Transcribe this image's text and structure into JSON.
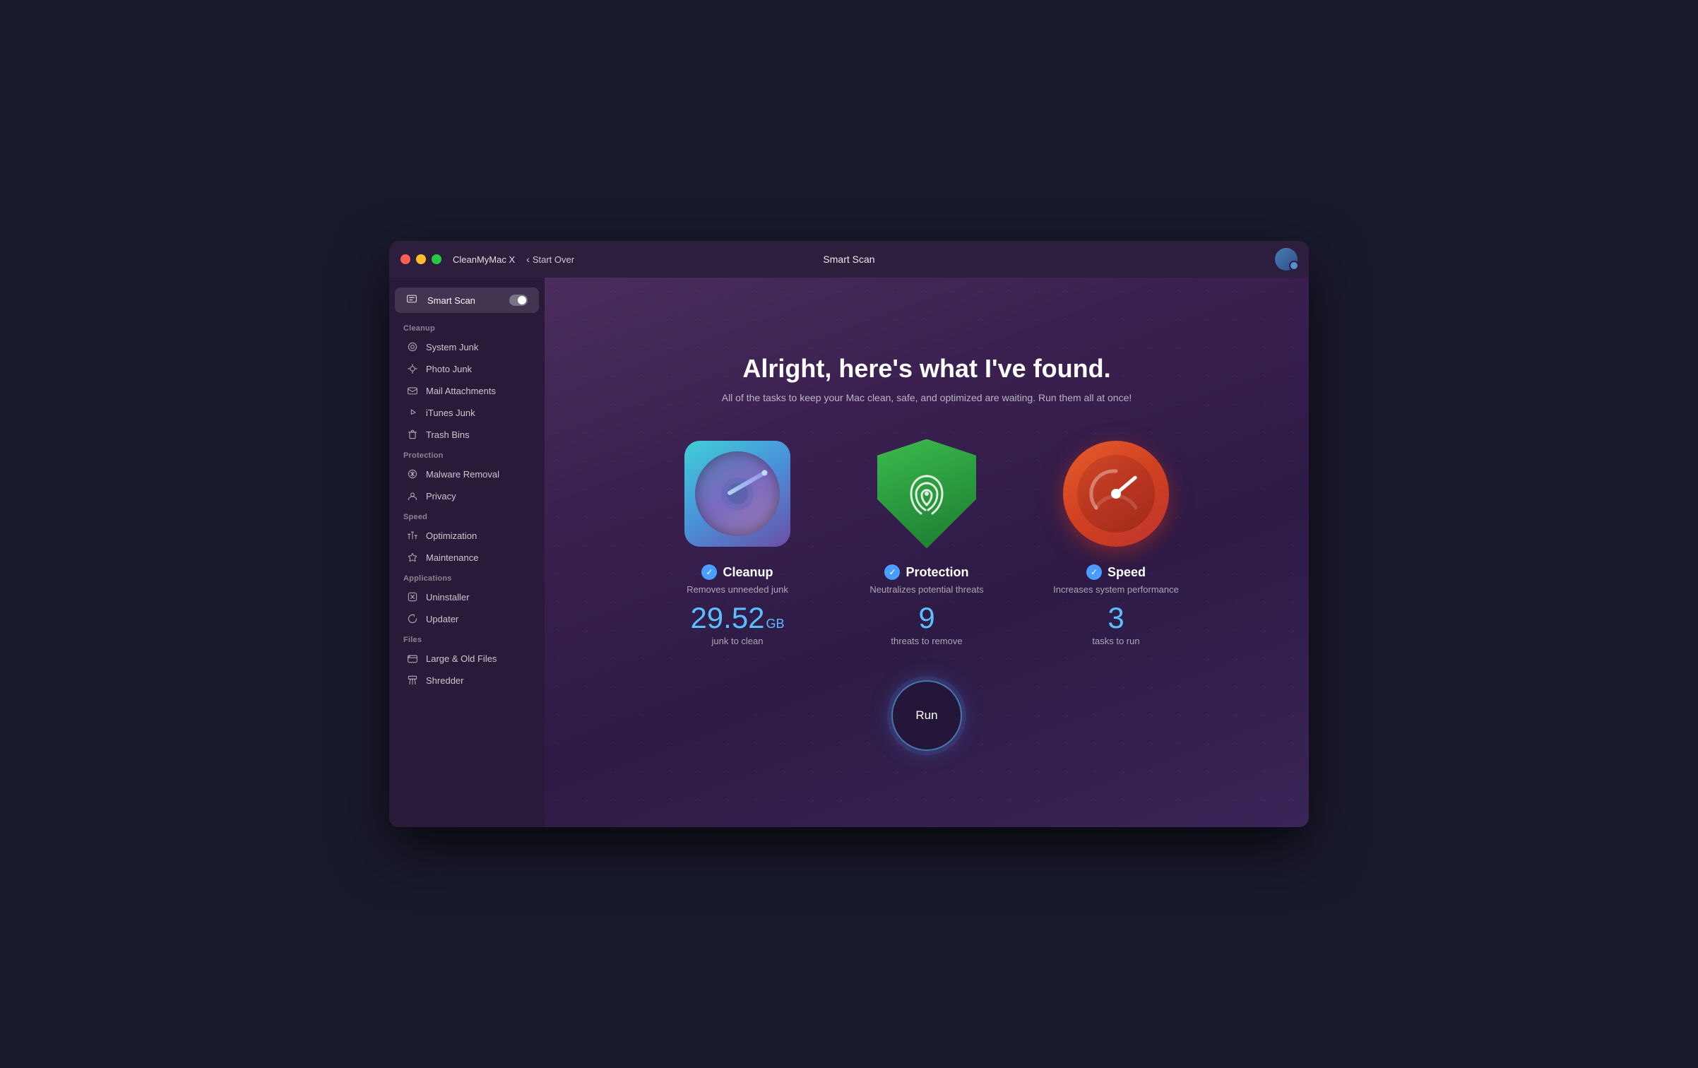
{
  "window": {
    "app_name": "CleanMyMac X",
    "nav_label": "Start Over",
    "title": "Smart Scan"
  },
  "sidebar": {
    "smart_scan_label": "Smart Scan",
    "sections": [
      {
        "name": "Cleanup",
        "items": [
          {
            "id": "system-junk",
            "label": "System Junk"
          },
          {
            "id": "photo-junk",
            "label": "Photo Junk"
          },
          {
            "id": "mail-attachments",
            "label": "Mail Attachments"
          },
          {
            "id": "itunes-junk",
            "label": "iTunes Junk"
          },
          {
            "id": "trash-bins",
            "label": "Trash Bins"
          }
        ]
      },
      {
        "name": "Protection",
        "items": [
          {
            "id": "malware-removal",
            "label": "Malware Removal"
          },
          {
            "id": "privacy",
            "label": "Privacy"
          }
        ]
      },
      {
        "name": "Speed",
        "items": [
          {
            "id": "optimization",
            "label": "Optimization"
          },
          {
            "id": "maintenance",
            "label": "Maintenance"
          }
        ]
      },
      {
        "name": "Applications",
        "items": [
          {
            "id": "uninstaller",
            "label": "Uninstaller"
          },
          {
            "id": "updater",
            "label": "Updater"
          }
        ]
      },
      {
        "name": "Files",
        "items": [
          {
            "id": "large-old-files",
            "label": "Large & Old Files"
          },
          {
            "id": "shredder",
            "label": "Shredder"
          }
        ]
      }
    ]
  },
  "content": {
    "title": "Alright, here's what I've found.",
    "subtitle": "All of the tasks to keep your Mac clean, safe, and optimized are waiting. Run them all at once!",
    "cards": [
      {
        "id": "cleanup",
        "name": "Cleanup",
        "description": "Removes unneeded junk",
        "stat_number": "29.52",
        "stat_unit": "GB",
        "stat_label": "junk to clean"
      },
      {
        "id": "protection",
        "name": "Protection",
        "description": "Neutralizes potential threats",
        "stat_number": "9",
        "stat_unit": "",
        "stat_label": "threats to remove"
      },
      {
        "id": "speed",
        "name": "Speed",
        "description": "Increases system performance",
        "stat_number": "3",
        "stat_unit": "",
        "stat_label": "tasks to run"
      }
    ],
    "run_button_label": "Run"
  }
}
